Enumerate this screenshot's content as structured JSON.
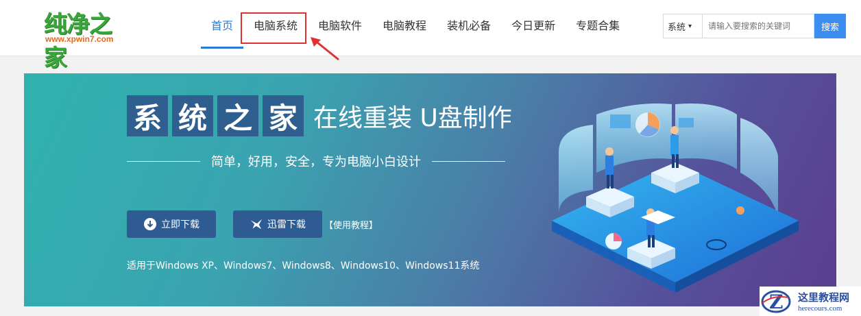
{
  "logo": {
    "main": "纯净之家",
    "url": "www.xpwin7.com"
  },
  "nav": {
    "items": [
      {
        "label": "首页",
        "active": true
      },
      {
        "label": "电脑系统",
        "active": false
      },
      {
        "label": "电脑软件",
        "active": false
      },
      {
        "label": "电脑教程",
        "active": false
      },
      {
        "label": "装机必备",
        "active": false
      },
      {
        "label": "今日更新",
        "active": false
      },
      {
        "label": "专题合集",
        "active": false
      }
    ]
  },
  "search": {
    "category": "系统",
    "placeholder": "请输入要搜索的关键词",
    "button": "搜索"
  },
  "banner": {
    "title_chars": [
      "系",
      "统",
      "之",
      "家"
    ],
    "title_sub": "在线重装 U盘制作",
    "slogan": "简单，好用，安全，专为电脑小白设计",
    "download_button": "立即下载",
    "thunder_button": "迅雷下载",
    "tutorial_link": "【使用教程】",
    "compat": "适用于Windows XP、Windows7、Windows8、Windows10、Windows11系统"
  },
  "watermark": {
    "cn": "这里教程网",
    "en": "herecours.com"
  },
  "colors": {
    "accent": "#2a7bd4",
    "highlight": "#e03030",
    "button": "#2f5b93",
    "logo_green": "#3aa53a"
  }
}
